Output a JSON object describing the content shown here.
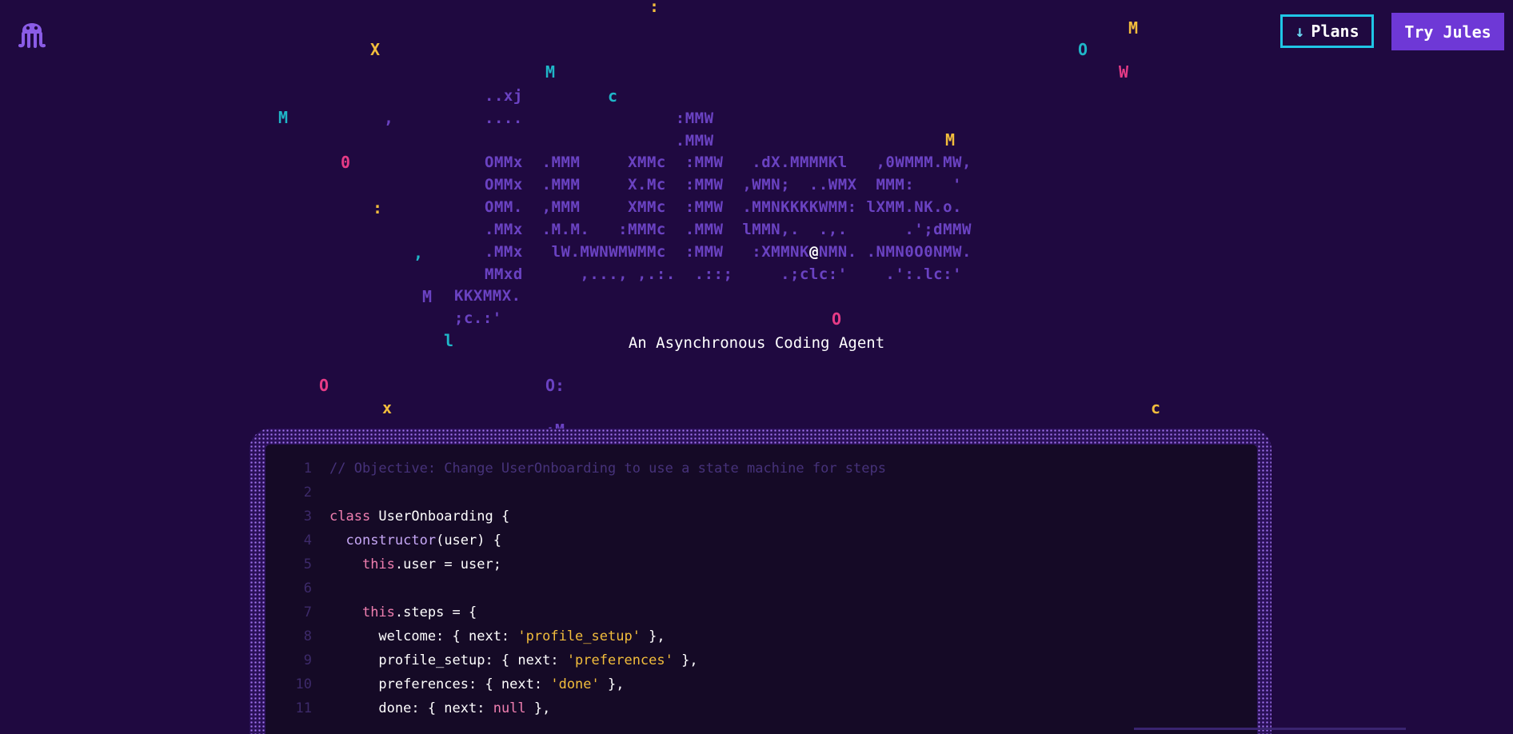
{
  "header": {
    "logo_icon": "octopus-icon",
    "plans_label": "Plans",
    "plans_icon": "arrow-down-icon",
    "plans_arrow": "↓",
    "try_label": "Try Jules"
  },
  "ascii_art": {
    "lines": [
      "..xj",
      "....                :MMW",
      "                    .MMW",
      "OMMx  .MMM     XMMc  :MMW   .dX.MMMMKl   ,0WMMM.MW,",
      "OMMx  .MMM     X.Mc  :MMW  ,WMN;  ..WMX  MMM:    '",
      "OMM.  ,MMM     XMMc  :MMW  .MMNKKKKWMM: lXMM.NK.o.",
      ".MMx  .M.M.   :MMMc  .MMW  lMMN,.  .,.      .';dMMW",
      ".MMx   lW.MWNWMWMMc  :MMW   :XMMNK@NMN. .NMN0O0NMW.",
      "MMxd      ,..., ,.:.  .::;     .;clc:'    .':.lc:'",
      "KKXMMX.",
      ";c.:'"
    ],
    "floating_chars": [
      {
        "char": ":",
        "color": "yellow"
      },
      {
        "char": "M",
        "color": "yellow"
      },
      {
        "char": "X",
        "color": "yellow"
      },
      {
        "char": "O",
        "color": "cyan"
      },
      {
        "char": "M",
        "color": "cyan"
      },
      {
        "char": "W",
        "color": "pink"
      },
      {
        "char": "c",
        "color": "cyan"
      },
      {
        "char": "M",
        "color": "cyan"
      },
      {
        "char": ",",
        "color": "purple"
      },
      {
        "char": "M",
        "color": "yellow"
      },
      {
        "char": "0",
        "color": "pink"
      },
      {
        "char": ":",
        "color": "yellow"
      },
      {
        "char": ",",
        "color": "cyan"
      },
      {
        "char": "M",
        "color": "purple"
      },
      {
        "char": "O",
        "color": "pink"
      },
      {
        "char": "l",
        "color": "cyan"
      },
      {
        "char": "O",
        "color": "pink"
      },
      {
        "char": "O:",
        "color": "purple"
      },
      {
        "char": "x",
        "color": "yellow"
      },
      {
        "char": "c",
        "color": "yellow"
      },
      {
        "char": ":M",
        "color": "purple"
      }
    ],
    "tagline": "An Asynchronous Coding Agent"
  },
  "code": {
    "lines": [
      {
        "num": "1",
        "tokens": [
          {
            "t": "comment",
            "v": "// Objective: Change UserOnboarding to use a state machine for steps"
          }
        ]
      },
      {
        "num": "2",
        "tokens": []
      },
      {
        "num": "3",
        "tokens": [
          {
            "t": "keyword",
            "v": "class "
          },
          {
            "t": "plain",
            "v": "UserOnboarding {"
          }
        ]
      },
      {
        "num": "4",
        "tokens": [
          {
            "t": "plain",
            "v": "  "
          },
          {
            "t": "func",
            "v": "constructor"
          },
          {
            "t": "plain",
            "v": "(user) {"
          }
        ]
      },
      {
        "num": "5",
        "tokens": [
          {
            "t": "plain",
            "v": "    "
          },
          {
            "t": "keyword",
            "v": "this"
          },
          {
            "t": "plain",
            "v": ".user = user;"
          }
        ]
      },
      {
        "num": "6",
        "tokens": []
      },
      {
        "num": "7",
        "tokens": [
          {
            "t": "plain",
            "v": "    "
          },
          {
            "t": "keyword",
            "v": "this"
          },
          {
            "t": "plain",
            "v": ".steps = {"
          }
        ]
      },
      {
        "num": "8",
        "tokens": [
          {
            "t": "plain",
            "v": "      welcome: { next: "
          },
          {
            "t": "string",
            "v": "'profile_setup'"
          },
          {
            "t": "plain",
            "v": " },"
          }
        ]
      },
      {
        "num": "9",
        "tokens": [
          {
            "t": "plain",
            "v": "      profile_setup: { next: "
          },
          {
            "t": "string",
            "v": "'preferences'"
          },
          {
            "t": "plain",
            "v": " },"
          }
        ]
      },
      {
        "num": "10",
        "tokens": [
          {
            "t": "plain",
            "v": "      preferences: { next: "
          },
          {
            "t": "string",
            "v": "'done'"
          },
          {
            "t": "plain",
            "v": " },"
          }
        ]
      },
      {
        "num": "11",
        "tokens": [
          {
            "t": "plain",
            "v": "      done: { next: "
          },
          {
            "t": "null",
            "v": "null"
          },
          {
            "t": "plain",
            "v": " },"
          }
        ]
      }
    ]
  },
  "colors": {
    "background": "#1f0940",
    "accent_purple": "#6e38d6",
    "accent_cyan": "#1fc6e6",
    "yellow": "#f2bd3c",
    "pink": "#e63b86"
  }
}
